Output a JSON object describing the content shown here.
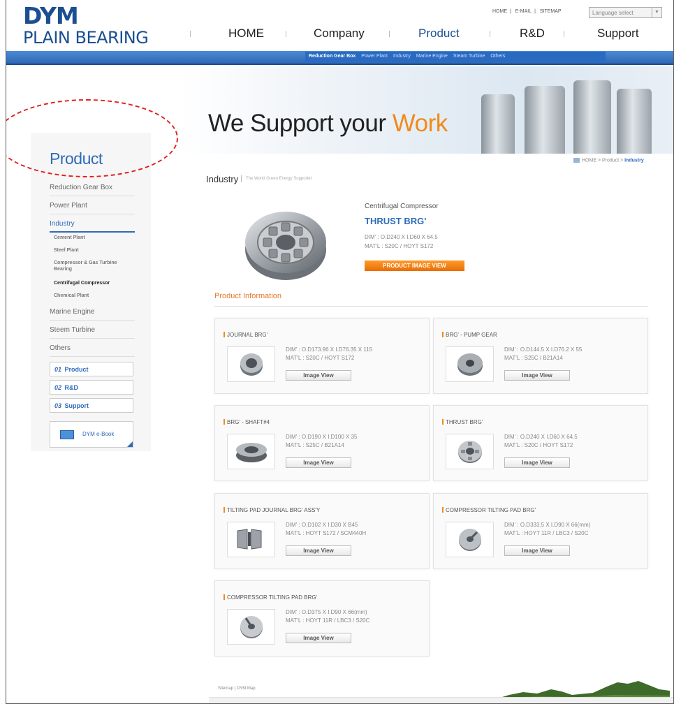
{
  "header": {
    "logo_top": "DYM",
    "logo_bottom": "PLAIN BEARING",
    "util_links": [
      "HOME",
      "E-MAIL",
      "SITEMAP"
    ],
    "language_select": "Language select",
    "gnb": [
      "HOME",
      "Company",
      "Product",
      "R&D",
      "Support"
    ],
    "active_gnb": "Product",
    "subnav": [
      "Reduction Gear Box",
      "Power Plant",
      "Industry",
      "Marine Engine",
      "Steam Turbine",
      "Others"
    ],
    "brand_color": "#1b4f92"
  },
  "hero": {
    "title_main": "We Support your ",
    "title_accent": "Work"
  },
  "sidebar": {
    "title": "Product",
    "items": [
      "Reduction Gear Box",
      "Power Plant",
      "Industry",
      "Marine Engine",
      "Steem Turbine",
      "Others"
    ],
    "active_item": "Industry",
    "subitems": [
      "Cement Plant",
      "Steel Plant",
      "Compressor & Gas Turbine Bearing",
      "Centrifugal Compressor",
      "Chemical Plant"
    ],
    "active_subitem": "Centrifugal Compressor",
    "quick_links": [
      {
        "num": "01",
        "label": "Product"
      },
      {
        "num": "02",
        "label": "R&D"
      },
      {
        "num": "03",
        "label": "Support"
      }
    ],
    "ebook_label": "DYM e-Book"
  },
  "breadcrumb": {
    "path": "HOME > Product > ",
    "current": "Industry"
  },
  "section": {
    "title": "Industry",
    "subtitle": "The World Green Energy Supporter"
  },
  "main_product": {
    "category": "Centrifugal Compressor",
    "name": "THRUST BRG'",
    "dim": "DIM' : O.D240 X I.D60 X 64.5",
    "mat": "MAT'L : S20C / HOYT S172",
    "button": "PRODUCT IMAGE VIEW",
    "accent_color": "#f08a1c"
  },
  "product_info": {
    "title": "Product Information",
    "button_label": "Image View",
    "cards": [
      {
        "title": "JOURNAL BRG'",
        "dim": "DIM' : O.D173.96 X I.D76.35 X 115",
        "mat": "MAT'L : S20C / HOYT S172"
      },
      {
        "title": "BRG' - PUMP GEAR",
        "dim": "DIM' : O.D144.5 X I.D76.2 X 55",
        "mat": "MAT'L : S25C / B21A14"
      },
      {
        "title": "BRG' - SHAFT#4",
        "dim": "DIM' : O.D190 X I.D100 X 35",
        "mat": "MAT'L : S25C / B21A14"
      },
      {
        "title": "THRUST BRG'",
        "dim": "DIM' : O.D240 X I.D60 X 64.5",
        "mat": "MAT'L : S20C / HOYT S172"
      },
      {
        "title": "TILTING PAD JOURNAL BRG' ASS'Y",
        "dim": "DIM' : O.D102 X I.D30 X B45",
        "mat": "MAT'L : HOYT S172 / SCM440H"
      },
      {
        "title": "COMPRESSOR TILTING PAD BRG'",
        "dim": "DIM' : O.D333.5 X I.D90 X 66(mm)",
        "mat": "MAT'L : HOYT 11R / LBC3 / S20C"
      },
      {
        "title": "COMPRESSOR TILTING PAD BRG'",
        "dim": "DIM' : O.D375 X I.D90 X 66(mm)",
        "mat": "MAT'L : HOYT 11R / LBC3 / S20C"
      }
    ]
  },
  "footer": {
    "links": "Sitemap | DYM Map"
  }
}
